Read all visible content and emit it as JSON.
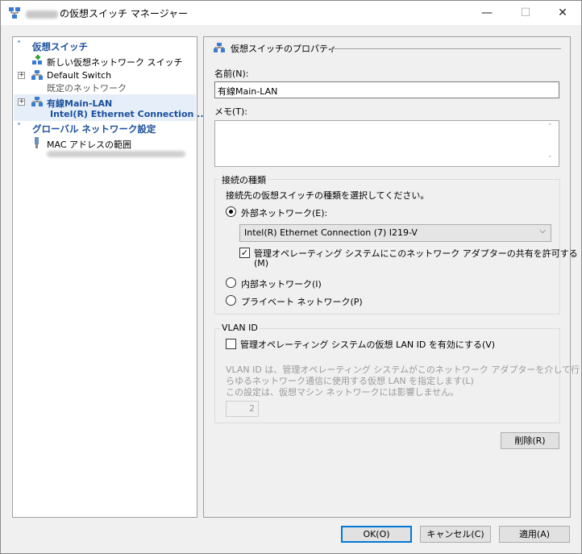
{
  "window": {
    "title": "の仮想スイッチ マネージャー",
    "minimize": "—",
    "maximize": "☐",
    "close": "✕"
  },
  "left": {
    "section_switches": "仮想スイッチ",
    "new_switch": "新しい仮想ネットワーク スイッチ",
    "default_switch": "Default Switch",
    "default_switch_sub": "既定のネットワーク",
    "wired_lan": "有線Main-LAN",
    "wired_lan_sub": "Intel(R) Ethernet Connection ...",
    "section_global": "グローバル ネットワーク設定",
    "mac_range": "MAC アドレスの範囲"
  },
  "props": {
    "header": "仮想スイッチのプロパティ",
    "name_label": "名前(N):",
    "name_value": "有線Main-LAN",
    "memo_label": "メモ(T):",
    "conn_group": "接続の種類",
    "conn_prompt": "接続先の仮想スイッチの種類を選択してください。",
    "external": "外部ネットワーク(E):",
    "adapter": "Intel(R) Ethernet Connection (7) I219-V",
    "allow_share_1": "管理オペレーティング システムにこのネットワーク アダプターの共有を許可する",
    "allow_share_2": "(M)",
    "internal": "内部ネットワーク(I)",
    "private": "プライベート ネットワーク(P)",
    "vlan_group": "VLAN ID",
    "vlan_enable": "管理オペレーティング システムの仮想 LAN ID を有効にする(V)",
    "vlan_desc_1": "VLAN ID は、管理オペレーティング システムがこのネットワーク アダプターを介して行うあ",
    "vlan_desc_2": "らゆるネットワーク通信に使用する仮想 LAN を指定します(L)",
    "vlan_desc_3": "この設定は、仮想マシン ネットワークには影響しません。",
    "vlan_value": "2",
    "delete": "削除(R)"
  },
  "footer": {
    "ok": "OK(O)",
    "cancel": "キャンセル(C)",
    "apply": "適用(A)"
  },
  "state": {
    "external_selected": true,
    "allow_share_checked": true,
    "vlan_checked": false
  }
}
